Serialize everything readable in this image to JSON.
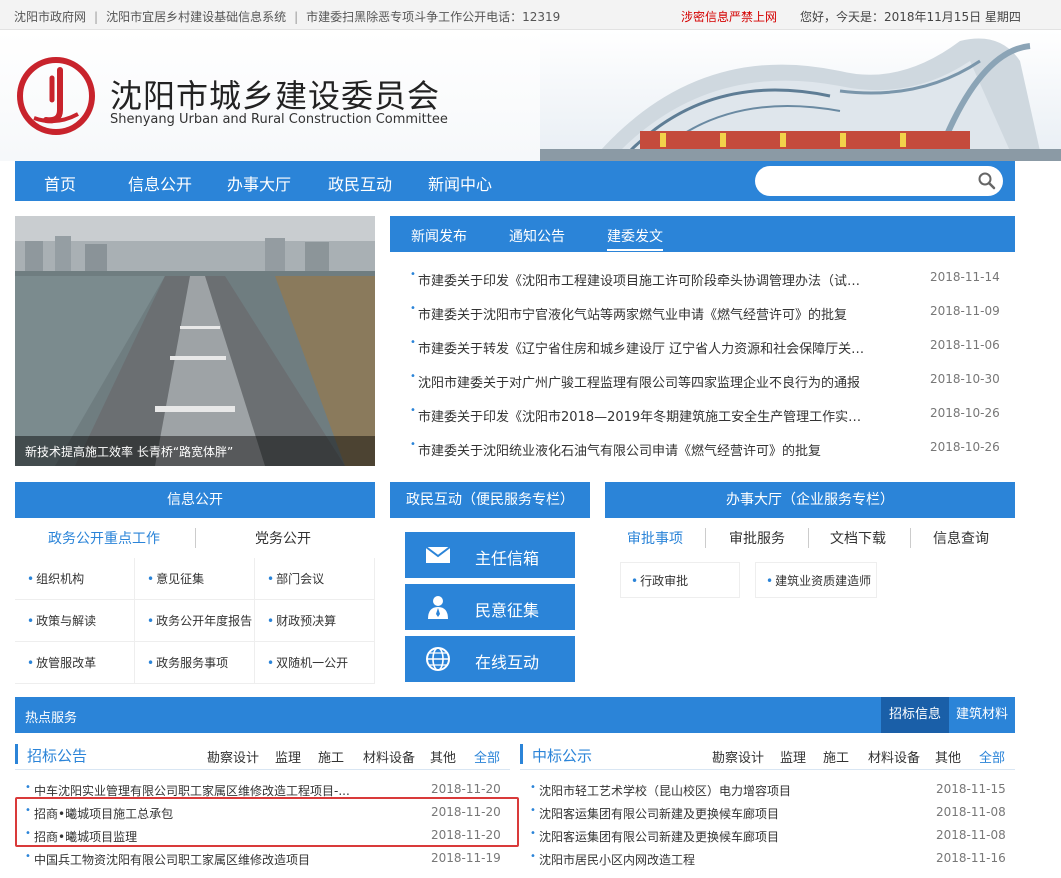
{
  "topbar": {
    "link1": "沈阳市政府网",
    "link2": "沈阳市宜居乡村建设基础信息系统",
    "hotline": "市建委扫黑除恶专项斗争工作公开电话：12319",
    "warning": "涉密信息严禁上网",
    "greeting": "您好，今天是：2018年11月15日 星期四"
  },
  "header": {
    "title": "沈阳市城乡建设委员会",
    "subtitle": "Shenyang Urban and Rural Construction Committee"
  },
  "nav": {
    "items": [
      "首页",
      "信息公开",
      "办事大厅",
      "政民互动",
      "新闻中心"
    ],
    "search_placeholder": ""
  },
  "banner": {
    "caption": "新技术提高施工效率 长青桥“路宽体胖”"
  },
  "news": {
    "tabs": [
      "新闻发布",
      "通知公告",
      "建委发文"
    ],
    "active_tab": "建委发文",
    "items": [
      {
        "title": "市建委关于印发《沈阳市工程建设项目施工许可阶段牵头协调管理办法（试行）...",
        "date": "2018-11-14"
      },
      {
        "title": "市建委关于沈阳市宁官液化气站等两家燃气业申请《燃气经营许可》的批复",
        "date": "2018-11-09"
      },
      {
        "title": "市建委关于转发《辽宁省住房和城乡建设厅 辽宁省人力资源和社会保障厅关于...",
        "date": "2018-11-06"
      },
      {
        "title": "沈阳市建委关于对广州广骏工程监理有限公司等四家监理企业不良行为的通报",
        "date": "2018-10-30"
      },
      {
        "title": "市建委关于印发《沈阳市2018—2019年冬期建筑施工安全生产管理工作实施方案...",
        "date": "2018-10-26"
      },
      {
        "title": "市建委关于沈阳统业液化石油气有限公司申请《燃气经营许可》的批复",
        "date": "2018-10-26"
      }
    ]
  },
  "info_panel": {
    "title": "信息公开",
    "tabs": [
      "政务公开重点工作",
      "党务公开"
    ],
    "items": [
      "组织机构",
      "意见征集",
      "部门会议",
      "政策与解读",
      "政务公开年度报告",
      "财政预决算",
      "放管服改革",
      "政务服务事项",
      "双随机一公开"
    ]
  },
  "interact_panel": {
    "title": "政民互动（便民服务专栏）",
    "buttons": [
      "主任信箱",
      "民意征集",
      "在线互动"
    ]
  },
  "hall_panel": {
    "title": "办事大厅（企业服务专栏）",
    "tabs": [
      "审批事项",
      "审批服务",
      "文档下载",
      "信息查询"
    ],
    "items": [
      "行政审批",
      "建筑业资质建造师"
    ]
  },
  "hot": {
    "title": "热点服务",
    "tabs": [
      "招标信息",
      "建筑材料"
    ]
  },
  "bids": {
    "title": "招标公告",
    "cats": [
      "勘察设计",
      "监理",
      "施工",
      "材料设备",
      "其他",
      "全部"
    ],
    "items": [
      {
        "title": "中车沈阳实业管理有限公司职工家属区维修改造工程项目-...",
        "date": "2018-11-20"
      },
      {
        "title": "招商•曦城项目施工总承包",
        "date": "2018-11-20"
      },
      {
        "title": "招商•曦城项目监理",
        "date": "2018-11-20"
      },
      {
        "title": "中国兵工物资沈阳有限公司职工家属区维修改造项目",
        "date": "2018-11-19"
      }
    ]
  },
  "awards": {
    "title": "中标公示",
    "cats": [
      "勘察设计",
      "监理",
      "施工",
      "材料设备",
      "其他",
      "全部"
    ],
    "items": [
      {
        "title": "沈阳市轻工艺术学校（昆山校区）电力增容项目",
        "date": "2018-11-15"
      },
      {
        "title": "沈阳客运集团有限公司新建及更换候车廊项目",
        "date": "2018-11-08"
      },
      {
        "title": "沈阳客运集团有限公司新建及更换候车廊项目",
        "date": "2018-11-08"
      },
      {
        "title": "沈阳市居民小区内网改造工程",
        "date": "2018-11-16"
      }
    ]
  },
  "colors": {
    "brand_blue": "#2b84d8",
    "warning_red": "#d40000",
    "highlight_red": "#d93a3a"
  }
}
